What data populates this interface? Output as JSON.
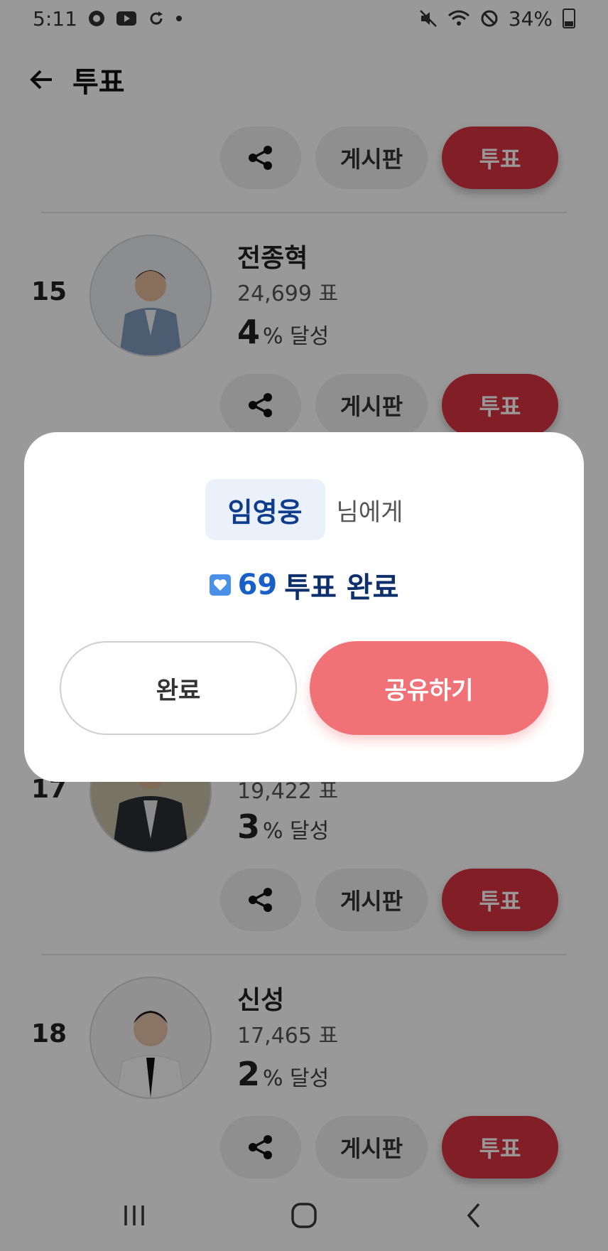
{
  "status_bar": {
    "time": "5:11",
    "battery": "34%",
    "left_icons": [
      "chat-icon",
      "youtube-icon",
      "sync-icon",
      "dot-icon"
    ],
    "right_icons": [
      "mute-icon",
      "wifi-icon",
      "do-not-disturb-icon",
      "battery-icon"
    ]
  },
  "header": {
    "title": "투표"
  },
  "actions": {
    "board_label": "게시판",
    "vote_label": "투표"
  },
  "candidates": [
    {
      "rank": "15",
      "name": "전종혁",
      "votes": "24,699 표",
      "percent": "4",
      "percent_suffix": "% 달성"
    },
    {
      "rank": "17",
      "name": "",
      "votes": "19,422 표",
      "percent": "3",
      "percent_suffix": "% 달성"
    },
    {
      "rank": "18",
      "name": "신성",
      "votes": "17,465 표",
      "percent": "2",
      "percent_suffix": "% 달성"
    }
  ],
  "dialog": {
    "recipient": "임영웅",
    "recipient_suffix": "님에게",
    "vote_count": "69",
    "vote_message": "투표 완료",
    "done_button": "완료",
    "share_button": "공유하기"
  },
  "colors": {
    "vote_red": "#d9323f",
    "share_pink": "#f07277",
    "recipient_blue": "#0d3d8c"
  }
}
